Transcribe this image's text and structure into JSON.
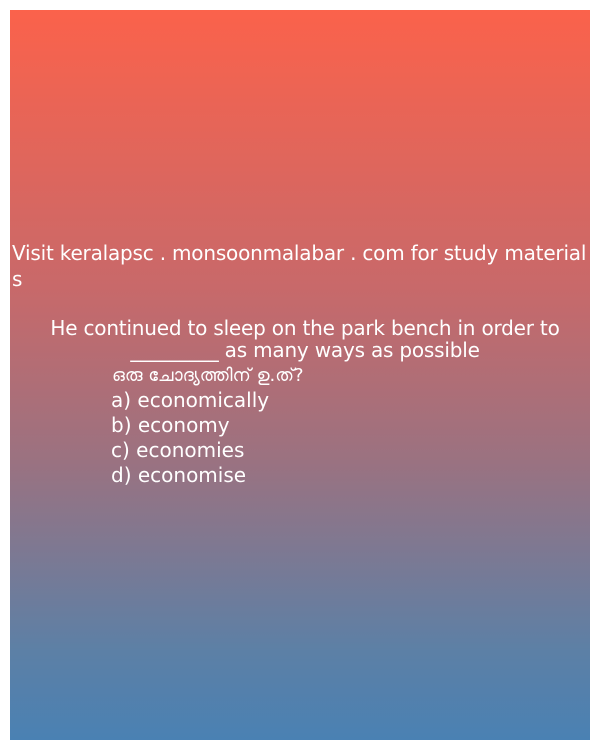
{
  "promo_text": "Visit keralapsc . monsoonmalabar . com for study materials",
  "question": "He continued to sleep on the park bench in order to _________ as many ways as possible",
  "malayalam_line": "ഒരു ചോദ്യത്തിന് ഉ.ത്?",
  "options": [
    "a) economically",
    "b) economy",
    "c) economies",
    "d) economise"
  ],
  "colors": {
    "gradient_top": "#fb624b",
    "gradient_bottom": "#4a81b3",
    "text": "#ffffff"
  }
}
